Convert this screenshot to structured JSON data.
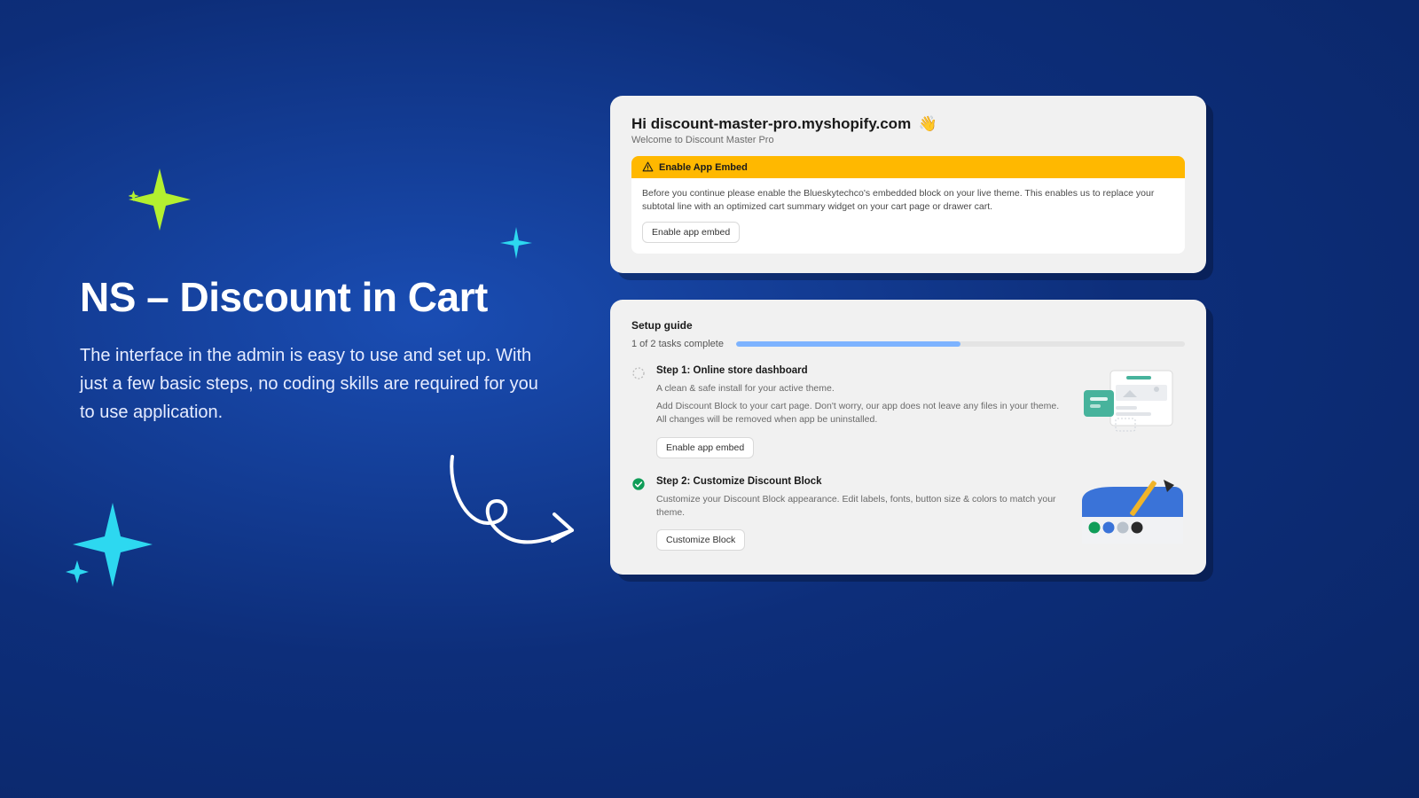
{
  "headline": "NS – Discount in Cart",
  "subhead": "The interface in the admin is easy to use and set up. With just a few basic steps, no coding skills are required for you to use  application.",
  "card1": {
    "greeting_prefix": "Hi ",
    "greeting_shop": "discount-master-pro.myshopify.com",
    "greeting_emoji": "👋",
    "welcome": "Welcome to Discount Master Pro",
    "alert_title": "Enable App Embed",
    "alert_body": "Before you continue please enable the Blueskytechco's embedded block on your live theme. This enables us to replace your subtotal line with an optimized cart summary widget on your cart page or drawer cart.",
    "alert_button": "Enable app embed"
  },
  "card2": {
    "title": "Setup guide",
    "progress_label": "1 of 2 tasks complete",
    "progress_percent": 50,
    "step1": {
      "title": "Step 1: Online store dashboard",
      "desc_a": "A clean & safe install for your active theme.",
      "desc_b": "Add Discount Block to your cart page. Don't worry, our app does not leave any files in your theme. All changes will be removed when app be uninstalled.",
      "button": "Enable app embed"
    },
    "step2": {
      "title": "Step 2: Customize Discount Block",
      "desc": "Customize your Discount Block appearance. Edit labels, fonts, button size & colors to match your theme.",
      "button": "Customize Block"
    }
  },
  "colors": {
    "accent_yellow": "#ffb800",
    "progress_blue": "#7db3ff",
    "sparkle_green": "#b3f030",
    "sparkle_cyan": "#2dd8f0",
    "check_green": "#0f9d58"
  }
}
